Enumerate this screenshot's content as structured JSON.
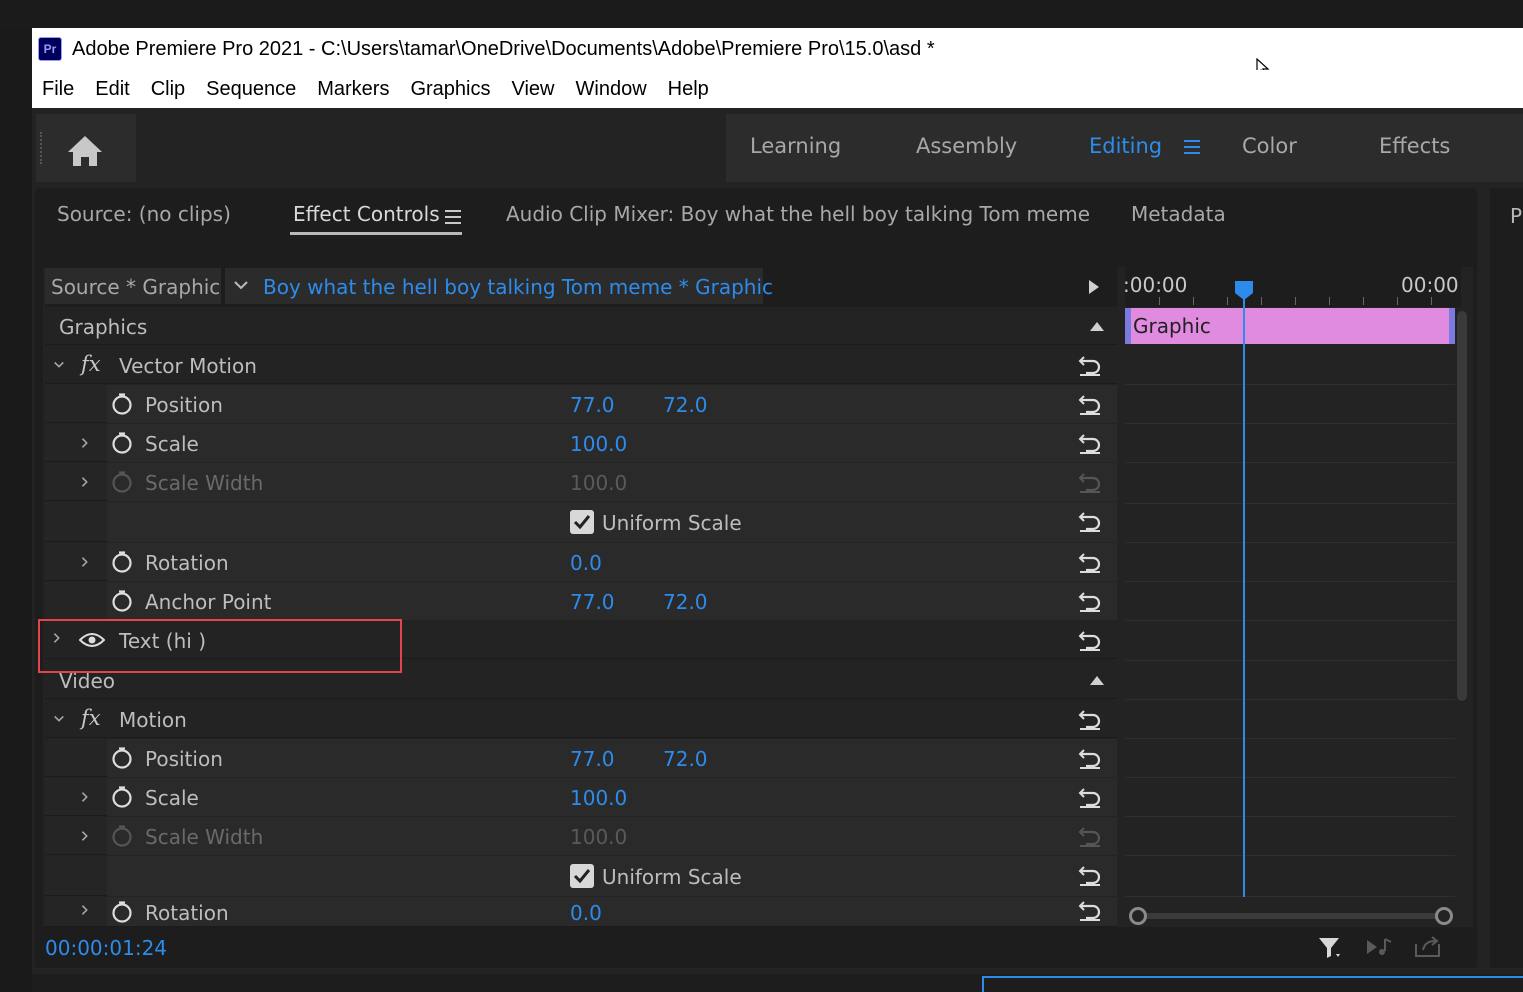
{
  "window": {
    "app_icon_text": "Pr",
    "title": "Adobe Premiere Pro 2021 - C:\\Users\\tamar\\OneDrive\\Documents\\Adobe\\Premiere Pro\\15.0\\asd *"
  },
  "menubar": [
    "File",
    "Edit",
    "Clip",
    "Sequence",
    "Markers",
    "Graphics",
    "View",
    "Window",
    "Help"
  ],
  "workspaces": {
    "tabs": [
      "Learning",
      "Assembly",
      "Editing",
      "Color",
      "Effects"
    ],
    "active": "Editing"
  },
  "panel_tabs": {
    "source": "Source: (no clips)",
    "effect_controls": "Effect Controls",
    "audio_mixer": "Audio Clip Mixer: Boy what the hell boy talking Tom meme",
    "metadata": "Metadata",
    "right_edge": "P"
  },
  "source_bar": {
    "source": "Source * Graphic",
    "clip": "Boy what the hell boy talking Tom meme * Graphic"
  },
  "timeline": {
    "time_start": ":00:00",
    "time_end": "00:00",
    "clip_label": "Graphic"
  },
  "graphics_section": {
    "title": "Graphics",
    "vector_motion": "Vector Motion",
    "fx": "fx",
    "position": {
      "label": "Position",
      "x": "77.0",
      "y": "72.0"
    },
    "scale": {
      "label": "Scale",
      "value": "100.0"
    },
    "scale_width": {
      "label": "Scale Width",
      "value": "100.0"
    },
    "uniform_scale": "Uniform Scale",
    "rotation": {
      "label": "Rotation",
      "value": "0.0"
    },
    "anchor_point": {
      "label": "Anchor Point",
      "x": "77.0",
      "y": "72.0"
    },
    "text_layer": "Text (hi )"
  },
  "video_section": {
    "title": "Video",
    "motion": "Motion",
    "fx": "fx",
    "position": {
      "label": "Position",
      "x": "77.0",
      "y": "72.0"
    },
    "scale": {
      "label": "Scale",
      "value": "100.0"
    },
    "scale_width": {
      "label": "Scale Width",
      "value": "100.0"
    },
    "uniform_scale": "Uniform Scale",
    "rotation": {
      "label": "Rotation",
      "value": "0.0"
    }
  },
  "footer": {
    "timecode": "00:00:01:24"
  },
  "colors": {
    "accent_blue": "#2d8ceb",
    "clip_pink": "#e08ae0",
    "highlight_red": "#e0464b"
  }
}
